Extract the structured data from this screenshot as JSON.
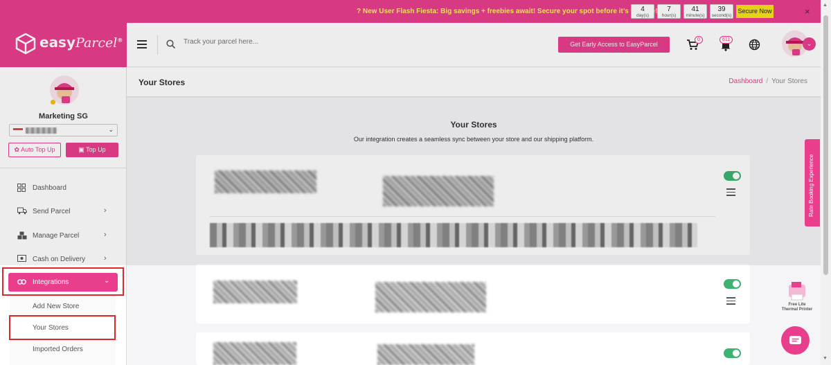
{
  "promo": {
    "text": "? New User Flash Fiesta: Big savings + freebies await! Secure your spot before it’s too late!",
    "countdown": [
      {
        "value": "4",
        "unit": "day(s)"
      },
      {
        "value": "7",
        "unit": "hour(s)"
      },
      {
        "value": "41",
        "unit": "minute(s)"
      },
      {
        "value": "39",
        "unit": "second(s)"
      }
    ],
    "cta": "Secure Now",
    "close": "×"
  },
  "brand": {
    "name_bold": "easy",
    "name_script": "Parcel",
    "mark": "®"
  },
  "header": {
    "search_placeholder": "Track your parcel here...",
    "nextgen_label": "Get Early Access to EasyParcel NextGen",
    "cart_count": "0",
    "notification_count": "611"
  },
  "sidebar": {
    "account_name": "Marketing SG",
    "auto_top_up": "Auto Top Up",
    "top_up": "Top Up",
    "nav": [
      {
        "label": "Dashboard"
      },
      {
        "label": "Send Parcel"
      },
      {
        "label": "Manage Parcel"
      },
      {
        "label": "Cash on Delivery"
      }
    ],
    "active": {
      "label": "Integrations"
    },
    "submenu": [
      {
        "label": "Add New Store"
      },
      {
        "label": "Your Stores"
      },
      {
        "label": "Imported Orders"
      }
    ]
  },
  "page": {
    "title": "Your Stores",
    "breadcrumb": {
      "home": "Dashboard",
      "sep": "/",
      "current": "Your Stores"
    },
    "heading": "Your Stores",
    "subheading": "Our integration creates a seamless sync between your store and our shipping platform."
  },
  "right": {
    "rate_tab": "Rate Booking Experience",
    "printer_promo": "Free Lite Thermal Printer"
  },
  "colors": {
    "brand": "#e83e8c",
    "promo_text": "#fff35c",
    "toggle_on": "#3cb371",
    "highlight_frame": "#e0262a"
  }
}
